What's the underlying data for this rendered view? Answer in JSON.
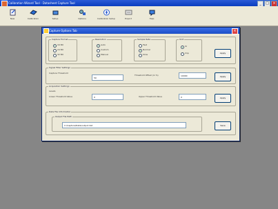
{
  "app": {
    "title": "Calibration Wizard Tool - Datasheet Capture Tool"
  },
  "toolbar": {
    "items": [
      {
        "label": "New"
      },
      {
        "label": "Calibration"
      },
      {
        "label": "Setup"
      },
      {
        "label": "Options"
      },
      {
        "label": "Calibration Setup"
      },
      {
        "label": "Export"
      },
      {
        "label": "Help"
      }
    ]
  },
  "dialog": {
    "title": "Capture Options Tab",
    "groups": {
      "g1": {
        "legend": "Capture Format",
        "options": [
          "16 Bit",
          "24 Bit",
          "32 Bit"
        ]
      },
      "g2": {
        "legend": "Resolution",
        "options": [
          "Auto",
          "Custom",
          "Manual"
        ]
      },
      "g3": {
        "legend": "Sample Rate",
        "options": [
          "Fast",
          "Normal",
          "Slow"
        ]
      },
      "g4": {
        "legend": "Unit",
        "options": [
          "SI",
          "Imp"
        ]
      }
    },
    "apply_label": "Apply",
    "section2": {
      "legend": "Signal Filter Settings",
      "left_label": "Capture Threshold",
      "left_value": "50",
      "right_label": "Threshold Offset (in %)",
      "right_value": "10000",
      "button": "Apply"
    },
    "section3": {
      "legend": "Acquisition Settings",
      "sublegend": "Levels",
      "left_label": "Lower Threshold Value",
      "left_value": "0",
      "right_label": "Upper Threshold Value",
      "right_value": "0",
      "button": "Apply"
    },
    "section4": {
      "legend": "Data File Information",
      "sublegend": "Output File Path",
      "path_value": "C:\\Capture\\Data\\output.dat",
      "button": "Save"
    }
  }
}
